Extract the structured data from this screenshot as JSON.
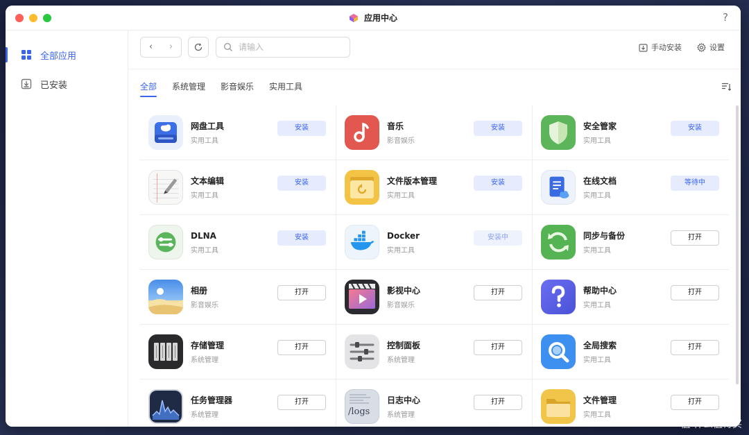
{
  "window": {
    "title": "应用中心",
    "help": "?"
  },
  "sidebar": {
    "items": [
      {
        "label": "全部应用",
        "icon": "grid-icon"
      },
      {
        "label": "已安装",
        "icon": "download-box-icon"
      }
    ]
  },
  "toolbar": {
    "back": "‹",
    "forward": "›",
    "search_placeholder": "请输入",
    "manual_install": "手动安装",
    "settings": "设置"
  },
  "tabs": [
    "全部",
    "系统管理",
    "影音娱乐",
    "实用工具"
  ],
  "apps": [
    {
      "name": "网盘工具",
      "category": "实用工具",
      "action": "安装",
      "state": "install",
      "icon": "cloud-drive-icon"
    },
    {
      "name": "音乐",
      "category": "影音娱乐",
      "action": "安装",
      "state": "install",
      "icon": "music-note-icon"
    },
    {
      "name": "安全管家",
      "category": "实用工具",
      "action": "安装",
      "state": "install",
      "icon": "shield-icon"
    },
    {
      "name": "文本编辑",
      "category": "实用工具",
      "action": "安装",
      "state": "install",
      "icon": "notepad-icon"
    },
    {
      "name": "文件版本管理",
      "category": "实用工具",
      "action": "安装",
      "state": "install",
      "icon": "version-folder-icon"
    },
    {
      "name": "在线文档",
      "category": "实用工具",
      "action": "等待中",
      "state": "waiting",
      "icon": "document-icon"
    },
    {
      "name": "DLNA",
      "category": "实用工具",
      "action": "安装",
      "state": "install",
      "icon": "dlna-icon"
    },
    {
      "name": "Docker",
      "category": "实用工具",
      "action": "安装中",
      "state": "installing",
      "icon": "docker-whale-icon"
    },
    {
      "name": "同步与备份",
      "category": "实用工具",
      "action": "打开",
      "state": "open",
      "icon": "sync-icon"
    },
    {
      "name": "相册",
      "category": "影音娱乐",
      "action": "打开",
      "state": "open",
      "icon": "photo-album-icon"
    },
    {
      "name": "影视中心",
      "category": "影音娱乐",
      "action": "打开",
      "state": "open",
      "icon": "video-play-icon"
    },
    {
      "name": "帮助中心",
      "category": "实用工具",
      "action": "打开",
      "state": "open",
      "icon": "question-icon"
    },
    {
      "name": "存储管理",
      "category": "系统管理",
      "action": "打开",
      "state": "open",
      "icon": "storage-drives-icon"
    },
    {
      "name": "控制面板",
      "category": "系统管理",
      "action": "打开",
      "state": "open",
      "icon": "sliders-icon"
    },
    {
      "name": "全局搜索",
      "category": "实用工具",
      "action": "打开",
      "state": "open",
      "icon": "magnifier-icon"
    },
    {
      "name": "任务管理器",
      "category": "系统管理",
      "action": "打开",
      "state": "open",
      "icon": "activity-graph-icon"
    },
    {
      "name": "日志中心",
      "category": "系统管理",
      "action": "打开",
      "state": "open",
      "icon": "logs-icon",
      "icon_text": "/logs"
    },
    {
      "name": "文件管理",
      "category": "实用工具",
      "action": "打开",
      "state": "open",
      "icon": "folder-icon"
    }
  ],
  "watermark": "值 什么值得买",
  "colors": {
    "accent": "#3a63f0",
    "install_bg": "#e6ecfd"
  }
}
